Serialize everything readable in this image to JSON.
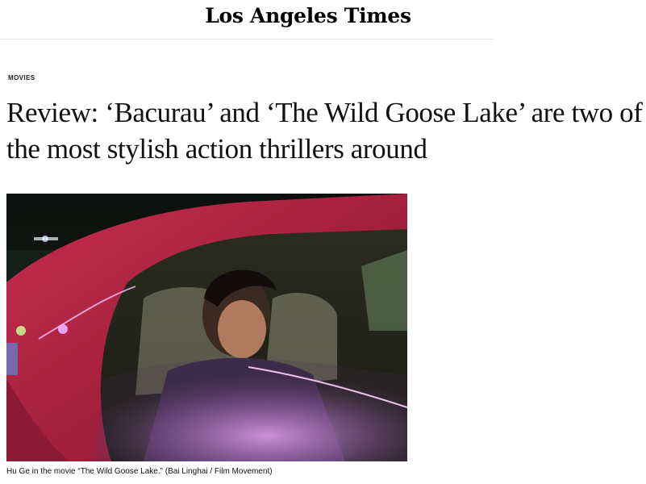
{
  "masthead": {
    "logo_text": "Los Angeles Times"
  },
  "article": {
    "section": "MOVIES",
    "headline": "Review: ‘Bacurau’ and ‘The Wild Goose Lake’ are two of the most stylish action thrillers around",
    "photo": {
      "caption": "Hu Ge in the movie “The Wild Goose Lake.” (Bai Linghai / Film Movement)"
    }
  },
  "colors": {
    "car_body": "#b0243f",
    "neon_glow": "#e88ff0",
    "night_sky": "#0e1210"
  }
}
